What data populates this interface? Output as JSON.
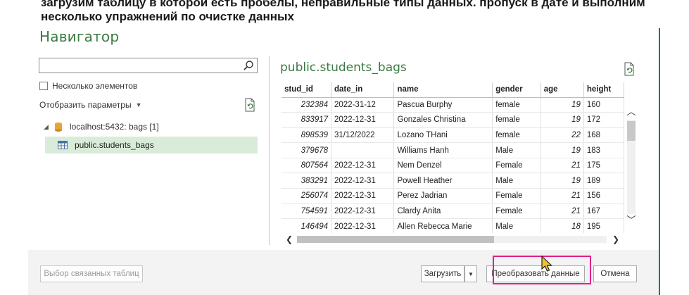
{
  "caption": "загрузим таблицу в которой есть пробелы, неправильные типы данных. пропуск в дате и выполним несколько упражнений по очистке данных",
  "window_title": "Навигатор",
  "left_panel": {
    "search_placeholder": "",
    "multi_select_label": "Несколько элементов",
    "display_params_label": "Отобразить параметры",
    "server_node": "localhost:5432: bags [1]",
    "table_node": "public.students_bags"
  },
  "preview": {
    "title": "public.students_bags",
    "columns": [
      "stud_id",
      "date_in",
      "name",
      "gender",
      "age",
      "height"
    ],
    "rows": [
      [
        "232384",
        "2022-31-12",
        "Pascua Burphy",
        "female",
        "19",
        "160"
      ],
      [
        "833917",
        "2022-12-31",
        "Gonzales Christina",
        "female",
        "19",
        "172"
      ],
      [
        "898539",
        "31/12/2022",
        "Lozano THani",
        "female",
        "22",
        "168"
      ],
      [
        "379678",
        "",
        "Williams Hanh",
        "Male",
        "19",
        "183"
      ],
      [
        "807564",
        "2022-12-31",
        "Nem Denzel",
        "Female",
        "21",
        "175"
      ],
      [
        "383291",
        "2022-12-31",
        "Powell Heather",
        "Male",
        "19",
        "189"
      ],
      [
        "256074",
        "2022-12-31",
        "Perez Jadrian",
        "Female",
        "21",
        "156"
      ],
      [
        "754591",
        "2022-12-31",
        "Clardy Anita",
        "Female",
        "21",
        "167"
      ],
      [
        "146494",
        "2022-12-31",
        "Allen Rebecca Marie",
        "Male",
        "18",
        "195"
      ]
    ]
  },
  "footer": {
    "related_tables_label": "Выбор связанных таблиц",
    "load_label": "Загрузить",
    "transform_label": "Преобразовать данные",
    "cancel_label": "Отмена"
  },
  "colors": {
    "accent_green": "#3a7a43",
    "selected_node_bg": "#d9ecd9",
    "highlight_box": "#e0218a"
  }
}
